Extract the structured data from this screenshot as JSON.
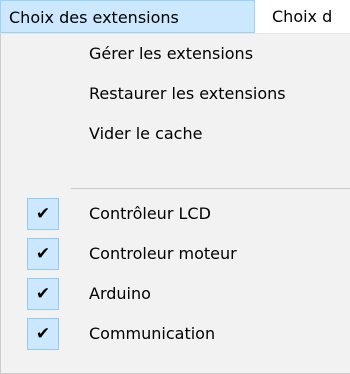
{
  "menubar": {
    "items": [
      {
        "label": "Choix des extensions"
      },
      {
        "label": "Choix d"
      }
    ]
  },
  "menu": {
    "actions": [
      {
        "label": "Gérer les extensions"
      },
      {
        "label": "Restaurer les extensions"
      },
      {
        "label": "Vider le cache"
      }
    ],
    "extensions": [
      {
        "label": "Contrôleur LCD",
        "checked": true
      },
      {
        "label": "Controleur moteur",
        "checked": true
      },
      {
        "label": "Arduino",
        "checked": true
      },
      {
        "label": "Communication",
        "checked": true
      }
    ],
    "check_glyph": "✔"
  },
  "colors": {
    "menubar_highlight": "#cce8ff",
    "menubar_highlight_border": "#99d1ff",
    "menu_background": "#f2f2f2",
    "check_box_background": "#cce8ff",
    "check_box_border": "#90c8f6"
  }
}
